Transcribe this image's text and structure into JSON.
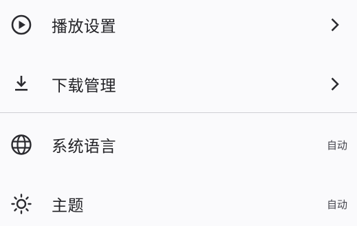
{
  "settings": {
    "playback": {
      "label": "播放设置",
      "icon": "play-circle-icon",
      "chevron": "chevron-right-icon"
    },
    "download": {
      "label": "下载管理",
      "icon": "download-icon",
      "chevron": "chevron-right-icon"
    },
    "language": {
      "label": "系统语言",
      "icon": "globe-icon",
      "value": "自动"
    },
    "theme": {
      "label": "主题",
      "icon": "brightness-icon",
      "value": "自动"
    }
  },
  "colors": {
    "background": "#fafafc",
    "text": "#222226",
    "icon": "#2b2b30",
    "divider": "#cfcfd4",
    "secondary_text": "#46464e"
  }
}
